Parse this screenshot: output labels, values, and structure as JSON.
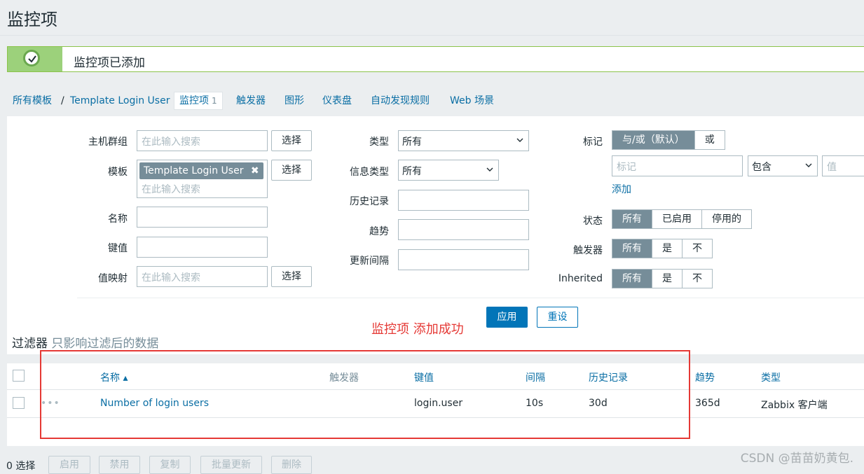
{
  "page": {
    "title": "监控项"
  },
  "message": {
    "text": "监控项已添加"
  },
  "breadcrumb": {
    "all_templates": "所有模板",
    "separator": "/",
    "template": "Template Login User",
    "tabs": [
      {
        "label": "监控项",
        "count": "1"
      },
      {
        "label": "触发器"
      },
      {
        "label": "图形"
      },
      {
        "label": "仪表盘"
      },
      {
        "label": "自动发现规则"
      },
      {
        "label": "Web 场景"
      }
    ]
  },
  "filter": {
    "host_group_label": "主机群组",
    "host_group_placeholder": "在此输入搜索",
    "select_label": "选择",
    "template_label": "模板",
    "template_tag": "Template Login User",
    "template_placeholder": "在此输入搜索",
    "name_label": "名称",
    "key_label": "键值",
    "valuemap_label": "值映射",
    "valuemap_placeholder": "在此输入搜索",
    "type_label": "类型",
    "type_value": "所有",
    "info_type_label": "信息类型",
    "info_type_value": "所有",
    "history_label": "历史记录",
    "trends_label": "趋势",
    "interval_label": "更新间隔",
    "tags_label": "标记",
    "tags_mode": [
      "与/或（默认）",
      "或"
    ],
    "tag_placeholder": "标记",
    "tag_operator": "包含",
    "tag_value_placeholder": "值",
    "add_label": "添加",
    "state_label": "状态",
    "state_options": [
      "所有",
      "已启用",
      "停用的"
    ],
    "triggers_label": "触发器",
    "triggers_options": [
      "所有",
      "是",
      "不"
    ],
    "inherited_label": "Inherited",
    "inherited_options": [
      "所有",
      "是",
      "不"
    ],
    "apply_label": "应用",
    "reset_label": "重设",
    "caption": "过滤器",
    "caption_sub": "只影响过滤后的数据"
  },
  "annotation": "监控项 添加成功",
  "table": {
    "headers": {
      "name": "名称 ▴",
      "triggers": "触发器",
      "key": "键值",
      "interval": "间隔",
      "history": "历史记录",
      "trends": "趋势",
      "type": "类型"
    },
    "rows": [
      {
        "dots": "•••",
        "name": "Number of login users",
        "key": "login.user",
        "interval": "10s",
        "history": "30d",
        "trends": "365d",
        "type": "Zabbix 客户端"
      }
    ]
  },
  "footer": {
    "selected": "0 选择",
    "buttons": [
      "启用",
      "禁用",
      "复制",
      "批量更新",
      "删除"
    ]
  },
  "watermark": "CSDN @苗苗奶黄包."
}
